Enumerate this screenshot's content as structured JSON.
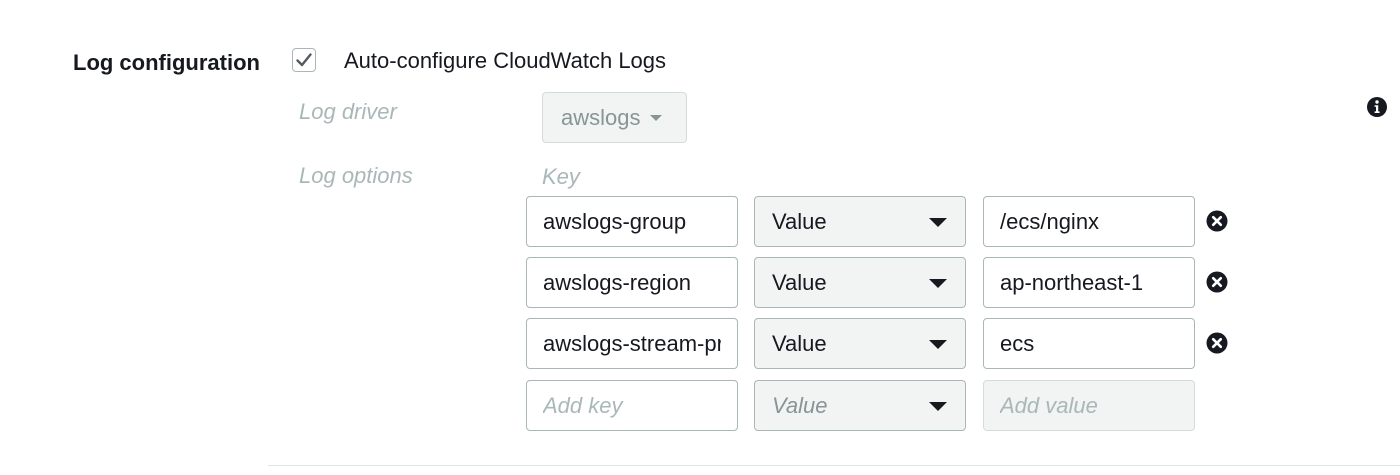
{
  "section": {
    "label": "Log configuration",
    "auto_configure_checked": true,
    "auto_configure_label": "Auto-configure CloudWatch Logs"
  },
  "log_driver": {
    "label": "Log driver",
    "selected": "awslogs",
    "info_icon": "info-icon"
  },
  "log_options": {
    "label": "Log options",
    "key_header": "Key",
    "rows": [
      {
        "key": "awslogs-group",
        "type": "Value",
        "value": "/ecs/nginx",
        "remove_icon": "remove-circle-icon"
      },
      {
        "key": "awslogs-region",
        "type": "Value",
        "value": "ap-northeast-1",
        "remove_icon": "remove-circle-icon"
      },
      {
        "key": "awslogs-stream-prefix",
        "type": "Value",
        "value": "ecs",
        "remove_icon": "remove-circle-icon"
      }
    ],
    "new_row": {
      "key_placeholder": "Add key",
      "type": "Value",
      "value_placeholder": "Add value"
    }
  }
}
